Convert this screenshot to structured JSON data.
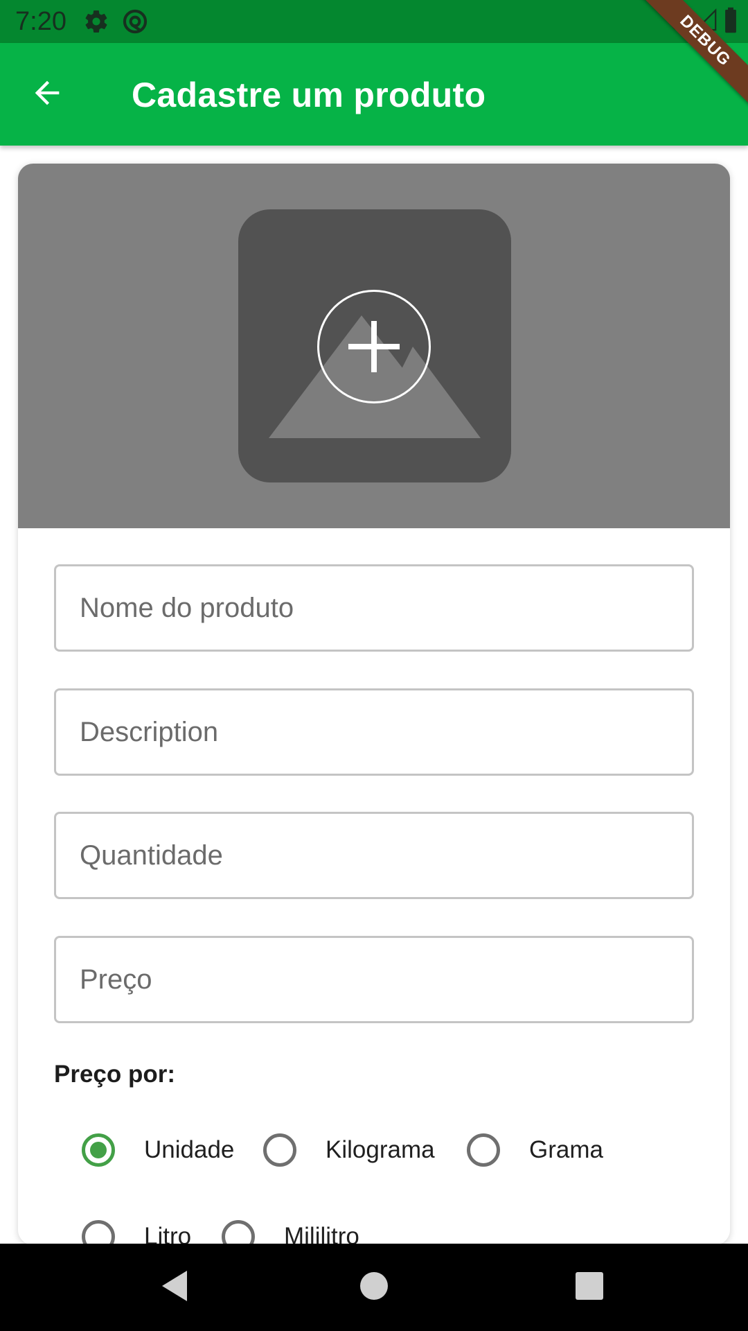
{
  "status_bar": {
    "time": "7:20",
    "icons_left": [
      "gear-icon",
      "at-sign-icon"
    ],
    "icons_right": [
      "wifi-icon",
      "signal-icon",
      "battery-icon"
    ]
  },
  "debug_banner": {
    "label": "DEBUG",
    "color": "#6d3b20"
  },
  "app_bar": {
    "title": "Cadastre um produto",
    "back_icon": "arrow-back-icon",
    "color": "#06b347"
  },
  "image_picker": {
    "placeholder_icon": "image-mountains-icon",
    "add_icon": "plus-icon"
  },
  "form": {
    "fields": [
      {
        "placeholder": "Nome do produto",
        "value": ""
      },
      {
        "placeholder": "Description",
        "value": ""
      },
      {
        "placeholder": "Quantidade",
        "value": ""
      },
      {
        "placeholder": "Preço",
        "value": ""
      }
    ],
    "price_unit_label": "Preço por:",
    "price_units": [
      {
        "label": "Unidade",
        "selected": true
      },
      {
        "label": "Kilograma",
        "selected": false
      },
      {
        "label": "Grama",
        "selected": false
      },
      {
        "label": "Litro",
        "selected": false
      },
      {
        "label": "Mililitro",
        "selected": false
      }
    ],
    "accent_color": "#43a047"
  },
  "nav_bar": {
    "buttons": [
      "back-triangle-icon",
      "home-circle-icon",
      "recents-square-icon"
    ]
  }
}
